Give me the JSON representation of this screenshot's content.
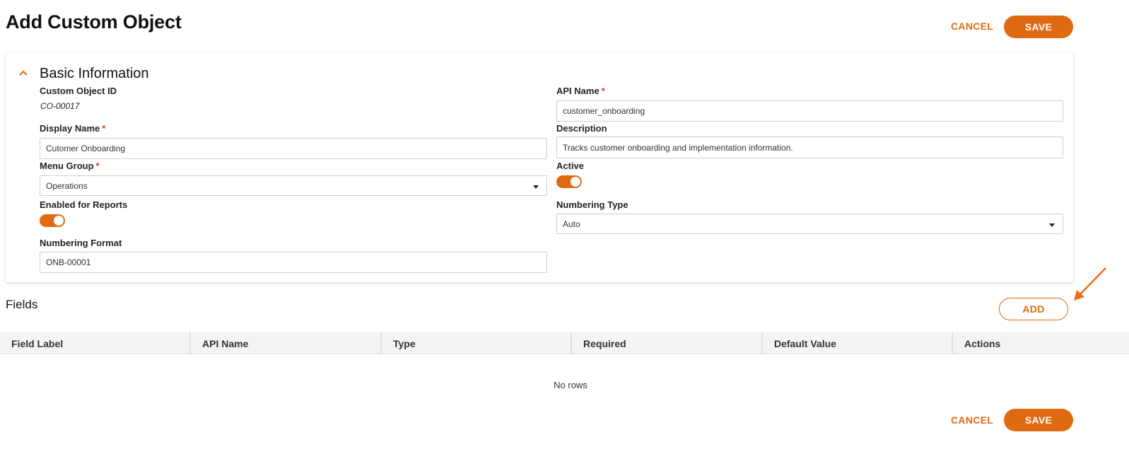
{
  "page": {
    "title": "Add Custom Object"
  },
  "header_actions": {
    "cancel_label": "CANCEL",
    "save_label": "SAVE"
  },
  "basic_info": {
    "section_title": "Basic Information",
    "custom_object_id": {
      "label": "Custom Object ID",
      "value": "CO-00017"
    },
    "api_name": {
      "label": "API Name",
      "required_mark": "*",
      "value": "customer_onboarding"
    },
    "display_name": {
      "label": "Display Name",
      "required_mark": "*",
      "value": "Cutomer Onboarding"
    },
    "description": {
      "label": "Description",
      "value": "Tracks customer onboarding and implementation information."
    },
    "menu_group": {
      "label": "Menu Group",
      "required_mark": "*",
      "value": "Operations"
    },
    "active": {
      "label": "Active",
      "on": true
    },
    "enabled_for_reports": {
      "label": "Enabled for Reports",
      "on": true
    },
    "numbering_type": {
      "label": "Numbering Type",
      "value": "Auto"
    },
    "numbering_format": {
      "label": "Numbering Format",
      "value": "ONB-00001"
    }
  },
  "fields": {
    "title": "Fields",
    "add_label": "ADD",
    "columns": [
      "Field Label",
      "API Name",
      "Type",
      "Required",
      "Default Value",
      "Actions"
    ],
    "empty_text": "No rows"
  },
  "footer_actions": {
    "cancel_label": "CANCEL",
    "save_label": "SAVE"
  },
  "colors": {
    "accent": "#e06a12",
    "required": "#d23c1e",
    "annotation_arrow": "#f26a1b"
  }
}
